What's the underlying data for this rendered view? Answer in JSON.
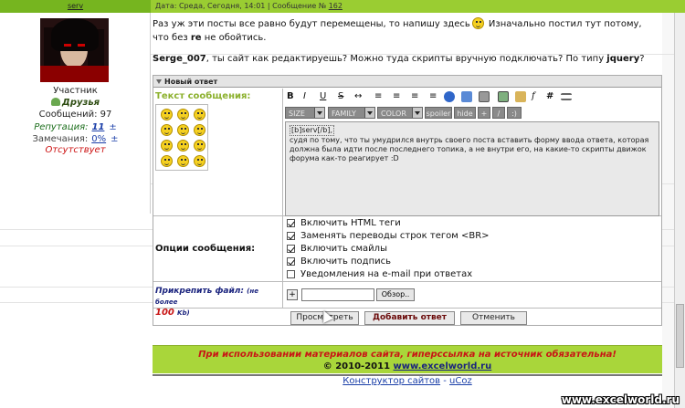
{
  "topbar": {
    "username": "serv",
    "meta_prefix": "Дата: Среда, Сегодня, 14:01 | Сообщение № ",
    "post_number": "162"
  },
  "user": {
    "role": "Участник",
    "group": "Друзья",
    "posts": "Сообщений: 97",
    "rep_label": "Репутация:",
    "rep_value": "11",
    "rep_pm": "±",
    "warn_label": "Замечания:",
    "warn_value": "0%",
    "warn_pm": "±",
    "status": "Отсутствует"
  },
  "post": {
    "p1_before": "Раз уж эти посты все равно будут перемещены, то напишу здесь",
    "p1_after_a": " Изначально постил тут потому, что без ",
    "p1_bold": "re",
    "p1_after_b": " не обойтись.",
    "p2_user": "Serge_007",
    "p2_mid": ", ты сайт как редактируешь? Можно туда скрипты вручную подключать? По типу ",
    "p2_bold": "jquery",
    "p2_end": "?"
  },
  "form": {
    "header": "Новый ответ",
    "text_label": "Текст сообщения:",
    "toolbar": [
      "B",
      "I",
      "U",
      "S",
      "↔",
      "≡",
      "≡",
      "≡",
      "≡"
    ],
    "selects": {
      "size": "SIZE",
      "family": "FAMILY",
      "color": "COLOR"
    },
    "buttons2": [
      "spoiler",
      "hide",
      "+",
      "/",
      ":)"
    ],
    "textarea_line1": "[b]serv[/b],",
    "textarea_body": "судя по тому, что ты умудрился внутрь своего поста вставить форму ввода ответа, которая должна была идти после последнего топика, а не внутри его, на какие-то скрипты движок форума как-то реагирует :D",
    "options_label": "Опции сообщения:",
    "options": [
      {
        "label": "Включить HTML теги",
        "checked": true
      },
      {
        "label": "Заменять переводы строк тегом <BR>",
        "checked": true
      },
      {
        "label": "Включить смайлы",
        "checked": true
      },
      {
        "label": "Включить подпись",
        "checked": true
      },
      {
        "label": "Уведомления на e-mail при ответах",
        "checked": false
      }
    ],
    "attach_label": "Прикрепить файл:",
    "attach_note": "(не более",
    "attach_size": "100",
    "attach_unit": "Kb)",
    "plus": "+",
    "browse": "Обзор..",
    "preview_btn": "Просмотреть",
    "submit_btn": "Добавить ответ",
    "cancel_btn": "Отменить"
  },
  "footer": {
    "notice": "При использовании материалов сайта, гиперссылка на источник обязательна!",
    "copyright": "© 2010-2011 ",
    "site": "www.excelworld.ru",
    "link1": "Конструктор сайтов",
    "sep": " - ",
    "link2": "uCoz"
  },
  "watermark": "www.excelworld.ru"
}
